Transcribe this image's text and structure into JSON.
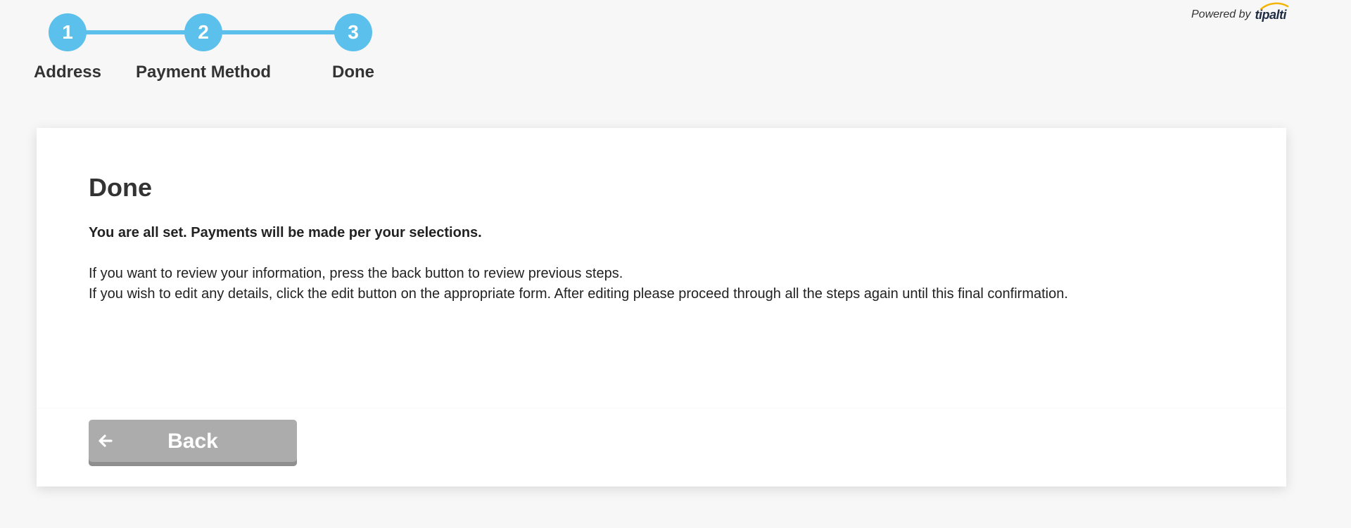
{
  "stepper": {
    "steps": [
      {
        "number": "1",
        "label": "Address"
      },
      {
        "number": "2",
        "label": "Payment Method"
      },
      {
        "number": "3",
        "label": "Done"
      }
    ],
    "color": "#5bc0eb"
  },
  "branding": {
    "powered_by": "Powered by",
    "logo_text": "tipalti",
    "logo_accent": "#f5b400"
  },
  "content": {
    "title": "Done",
    "subtitle": "You are all set. Payments will be made per your selections.",
    "line1": "If you want to review your information, press the back button to review previous steps.",
    "line2": "If you wish to edit any details, click the edit button on the appropriate form. After editing please proceed through all the steps again until this final confirmation."
  },
  "footer": {
    "back_label": "Back",
    "back_icon": "arrow-left-icon"
  }
}
